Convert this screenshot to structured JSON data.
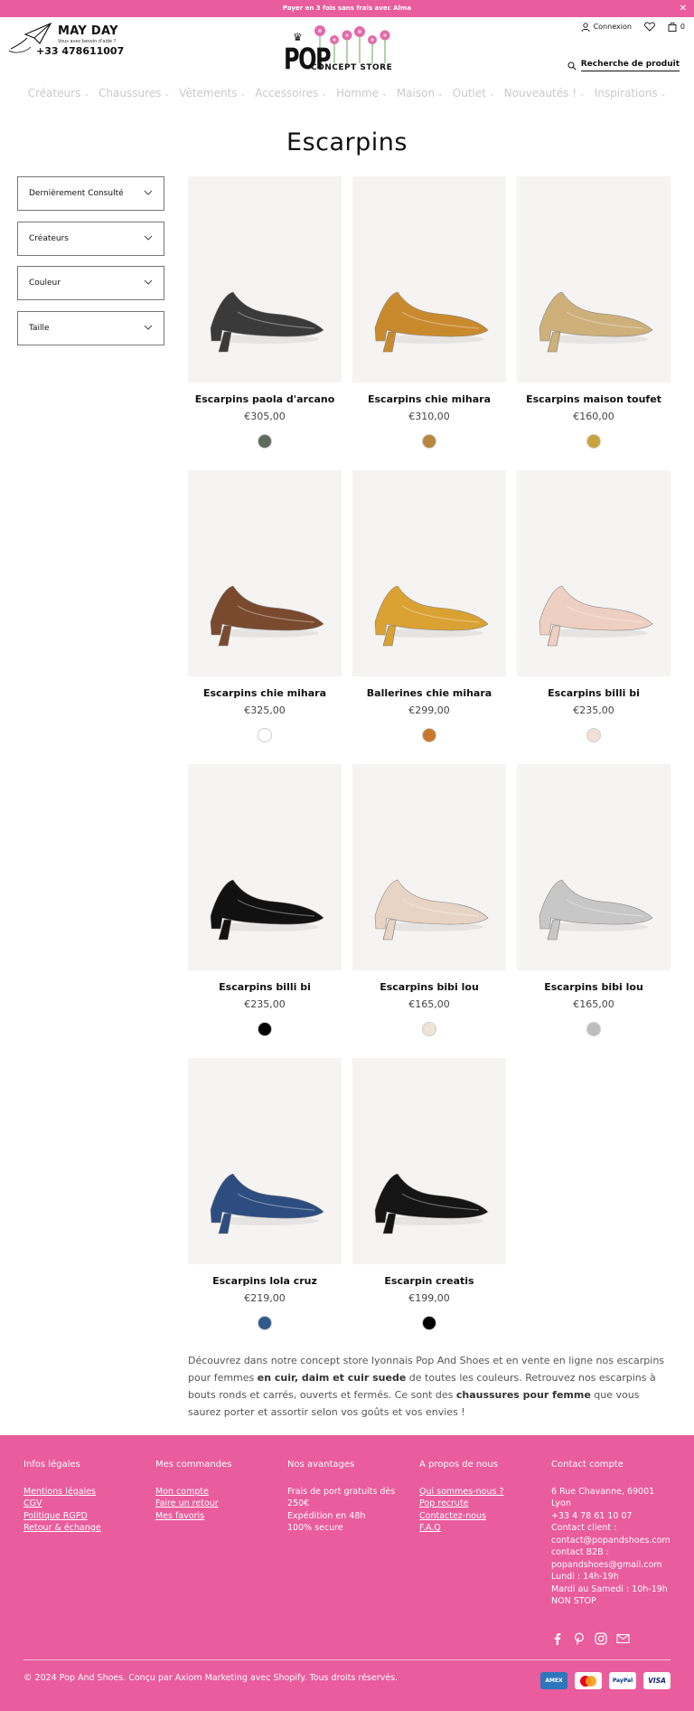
{
  "announcement": {
    "text": "Payer en 3 fois sans frais avec Alma",
    "close": "✕"
  },
  "mayday": {
    "title": "MAY DAY",
    "subtitle": "Vous avez besoin d'aide ?",
    "phone": "+33 478611007"
  },
  "logo": {
    "brand": "POP",
    "tagline": "CONCEPT STORE"
  },
  "header": {
    "login": "Connexion",
    "cart_count": "0",
    "search_placeholder": "Recherche de produit"
  },
  "nav": [
    {
      "label": "Créateurs"
    },
    {
      "label": "Chaussures"
    },
    {
      "label": "Vêtements"
    },
    {
      "label": "Accessoires"
    },
    {
      "label": "Homme"
    },
    {
      "label": "Maison"
    },
    {
      "label": "Outlet"
    },
    {
      "label": "Nouveautés !"
    },
    {
      "label": "Inspirations"
    }
  ],
  "page_title": "Escarpins",
  "filters": [
    {
      "label": "Dernièrement Consulté"
    },
    {
      "label": "Créateurs"
    },
    {
      "label": "Couleur"
    },
    {
      "label": "Taille"
    }
  ],
  "products": [
    {
      "name": "Escarpins paola d'arcano",
      "price": "€305,00",
      "swatch": "#5c6b5a"
    },
    {
      "name": "Escarpins chie mihara",
      "price": "€310,00",
      "swatch": "#b8873f"
    },
    {
      "name": "Escarpins maison toufet",
      "price": "€160,00",
      "swatch": "#c9a43c"
    },
    {
      "name": "Escarpins chie mihara",
      "price": "€325,00",
      "swatch": "#ffffff"
    },
    {
      "name": "Ballerines chie mihara",
      "price": "€299,00",
      "swatch": "#c9782a"
    },
    {
      "name": "Escarpins billi bi",
      "price": "€235,00",
      "swatch": "#f1e0d6"
    },
    {
      "name": "Escarpins billi bi",
      "price": "€235,00",
      "swatch": "#000000"
    },
    {
      "name": "Escarpins bibi lou",
      "price": "€165,00",
      "swatch": "#ede4d6"
    },
    {
      "name": "Escarpins bibi lou",
      "price": "€165,00",
      "swatch": "#bdbdbd"
    },
    {
      "name": "Escarpins lola cruz",
      "price": "€219,00",
      "swatch": "#2f5a8a"
    },
    {
      "name": "Escarpin creatis",
      "price": "€199,00",
      "swatch": "#000000"
    }
  ],
  "description": {
    "p1": "Découvrez dans notre concept store lyonnais Pop And Shoes et en vente en ligne nos escarpins pour femmes ",
    "b1": "en cuir, daim et cuir suede",
    "p2": " de toutes les couleurs. Retrouvez nos escarpins à bouts ronds et carrés, ouverts et fermés. Ce sont des ",
    "b2": "chaussures pour femme",
    "p3": " que vous saurez porter et assortir selon vos goûts et vos envies !"
  },
  "footer": {
    "legal": {
      "title": "Infos légales",
      "links": [
        "Mentions légales",
        "CGV",
        "Politique RGPD",
        "Retour & échange"
      ]
    },
    "orders": {
      "title": "Mes commandes",
      "links": [
        "Mon compte",
        "Faire un retour",
        "Mes favoris"
      ]
    },
    "advantages": {
      "title": "Nos avantages",
      "lines": [
        "Frais de port gratuits dès",
        "250€",
        "Expédition en 48h",
        "100% secure"
      ]
    },
    "about": {
      "title": "A propos de nous",
      "links": [
        "Qui sommes-nous ?",
        "Pop recrute",
        "Contactez-nous",
        "F.A.Q"
      ]
    },
    "contact": {
      "title": "Contact compte",
      "lines": [
        "6 Rue Chavanne, 69001",
        "Lyon",
        "+33 4 78 61 10 07",
        "Contact client :",
        "contact@popandshoes.com",
        "contact B2B :",
        "popandshoes@gmail.com",
        "Lundi : 14h-19h",
        "Mardi au Samedi : 10h-19h",
        "NON STOP"
      ]
    },
    "copyright": "© 2024 Pop And Shoes. Conçu par Axiom Marketing avec Shopify. Tous droits réservés.",
    "payments": [
      "AMEX",
      "MC",
      "PayPal",
      "VISA"
    ]
  },
  "colors": {
    "brand_pink": "#e95c9d"
  }
}
